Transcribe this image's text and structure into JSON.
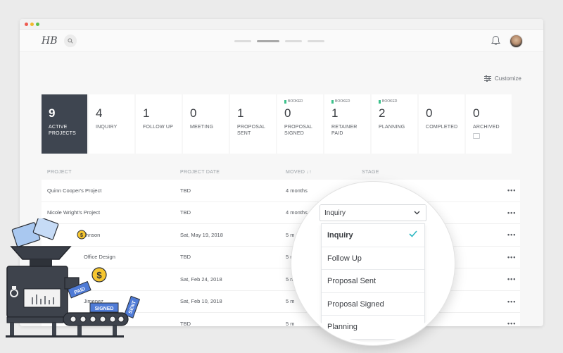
{
  "app": {
    "logo_text": "HB"
  },
  "header": {
    "customize_label": "Customize"
  },
  "stages": [
    {
      "count": "9",
      "label": "ACTIVE PROJECTS",
      "active": true,
      "booked": ""
    },
    {
      "count": "4",
      "label": "INQUIRY",
      "active": false,
      "booked": ""
    },
    {
      "count": "1",
      "label": "FOLLOW UP",
      "active": false,
      "booked": ""
    },
    {
      "count": "0",
      "label": "MEETING",
      "active": false,
      "booked": ""
    },
    {
      "count": "1",
      "label": "PROPOSAL SENT",
      "active": false,
      "booked": ""
    },
    {
      "count": "0",
      "label": "PROPOSAL SIGNED",
      "active": false,
      "booked": "BOOKED"
    },
    {
      "count": "1",
      "label": "RETAINER PAID",
      "active": false,
      "booked": "BOOKED"
    },
    {
      "count": "2",
      "label": "PLANNING",
      "active": false,
      "booked": "BOOKED"
    },
    {
      "count": "0",
      "label": "COMPLETED",
      "active": false,
      "booked": ""
    },
    {
      "count": "0",
      "label": "ARCHIVED",
      "active": false,
      "booked": ""
    }
  ],
  "table": {
    "headers": {
      "project": "PROJECT",
      "date": "PROJECT DATE",
      "moved": "MOVED ↓↑",
      "stage": "STAGE"
    },
    "rows": [
      {
        "project": "Quinn Cooper's Project",
        "date": "TBD",
        "moved": "4 months"
      },
      {
        "project": "Nicole Wright's Project",
        "date": "TBD",
        "moved": "4 months"
      },
      {
        "project": "Johnson",
        "date": "Sat, May 19, 2018",
        "moved": "5 m"
      },
      {
        "project": "Office Design",
        "date": "TBD",
        "moved": "5 m"
      },
      {
        "project": "",
        "date": "Sat, Feb 24, 2018",
        "moved": "5 m"
      },
      {
        "project": "Jimenez",
        "date": "Sat, Feb 10, 2018",
        "moved": "5 m"
      },
      {
        "project": "",
        "date": "TBD",
        "moved": "5 m"
      }
    ],
    "more_label": "•••"
  },
  "stage_dropdown": {
    "selected": "Inquiry",
    "options": [
      "Inquiry",
      "Follow Up",
      "Proposal Sent",
      "Proposal Signed",
      "Planning"
    ]
  },
  "illustration": {
    "tags": [
      "PAID",
      "SIGNED",
      "SENT"
    ],
    "coin_symbol": "$"
  },
  "colors": {
    "active_card": "#3e4550",
    "booked_green": "#3cc18b",
    "check_teal": "#2cb7c2",
    "tag_blue": "#4f7bd6"
  }
}
